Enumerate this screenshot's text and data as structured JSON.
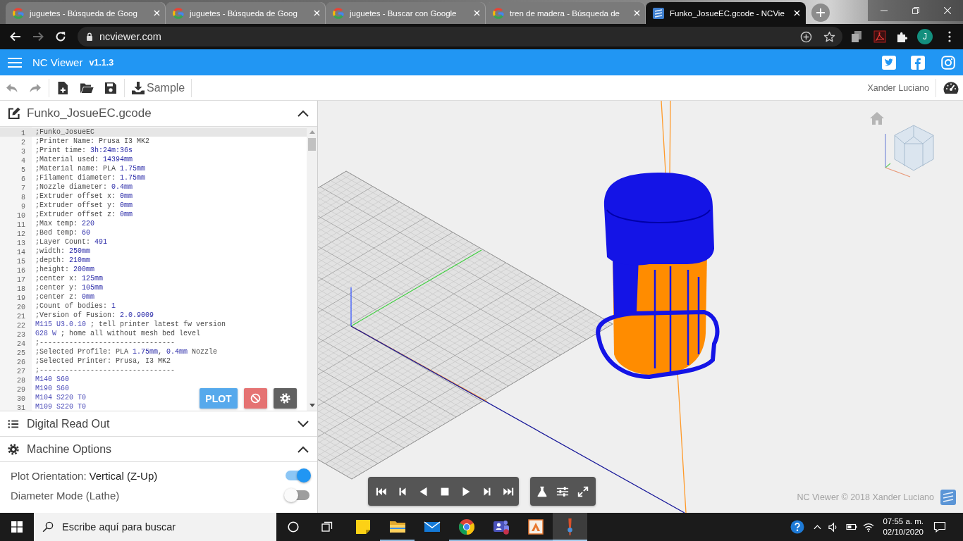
{
  "browser": {
    "tabs": [
      {
        "kind": "search",
        "title": "juguetes - Búsqueda de Goog",
        "selected": false
      },
      {
        "kind": "search",
        "title": "juguetes - Búsqueda de Goog",
        "selected": false
      },
      {
        "kind": "search",
        "title": "juguetes - Buscar con Google",
        "selected": false
      },
      {
        "kind": "search",
        "title": "tren de madera - Búsqueda de",
        "selected": false
      },
      {
        "kind": "app",
        "title": "Funko_JosueEC.gcode - NCVie",
        "selected": true
      }
    ],
    "back": {
      "disabled": false
    },
    "forward": {
      "disabled": true
    },
    "url": "ncviewer.com",
    "profile_initial": "J"
  },
  "app_bar": {
    "title": "NC Viewer",
    "version": "v1.1.3"
  },
  "toolbar": {
    "undo": {
      "disabled": true
    },
    "redo": {
      "disabled": true
    },
    "sample_button": "Sample",
    "author": "Xander Luciano"
  },
  "file_panel": {
    "title": "Funko_JosueEC.gcode",
    "expanded": true,
    "plot_button": "PLOT",
    "lines": [
      {
        "number": "1",
        "code": ";Funko_JosueEC",
        "selected": true
      },
      {
        "number": "2",
        "code": ";Printer Name: Prusa I3 MK2",
        "selected": false
      },
      {
        "number": "3",
        "code": ";Print time: 3h:24m:36s",
        "selected": false
      },
      {
        "number": "4",
        "code": ";Material used: 14394mm",
        "selected": false
      },
      {
        "number": "5",
        "code": ";Material name: PLA 1.75mm",
        "selected": false
      },
      {
        "number": "6",
        "code": ";Filament diameter: 1.75mm",
        "selected": false
      },
      {
        "number": "7",
        "code": ";Nozzle diameter: 0.4mm",
        "selected": false
      },
      {
        "number": "8",
        "code": ";Extruder offset x: 0mm",
        "selected": false
      },
      {
        "number": "9",
        "code": ";Extruder offset y: 0mm",
        "selected": false
      },
      {
        "number": "10",
        "code": ";Extruder offset z: 0mm",
        "selected": false
      },
      {
        "number": "11",
        "code": ";Max temp: 220",
        "selected": false
      },
      {
        "number": "12",
        "code": ";Bed temp: 60",
        "selected": false
      },
      {
        "number": "13",
        "code": ";Layer Count: 491",
        "selected": false
      },
      {
        "number": "14",
        "code": ";width: 250mm",
        "selected": false
      },
      {
        "number": "15",
        "code": ";depth: 210mm",
        "selected": false
      },
      {
        "number": "16",
        "code": ";height: 200mm",
        "selected": false
      },
      {
        "number": "17",
        "code": ";center x: 125mm",
        "selected": false
      },
      {
        "number": "18",
        "code": ";center y: 105mm",
        "selected": false
      },
      {
        "number": "19",
        "code": ";center z: 0mm",
        "selected": false
      },
      {
        "number": "20",
        "code": ";Count of bodies: 1",
        "selected": false
      },
      {
        "number": "21",
        "code": ";Version of Fusion: 2.0.9009",
        "selected": false
      },
      {
        "number": "22",
        "code": "M115 U3.0.10 ; tell printer latest fw version",
        "selected": false
      },
      {
        "number": "23",
        "code": "G28 W ; home all without mesh bed level",
        "selected": false
      },
      {
        "number": "24",
        "code": ";--------------------------------",
        "selected": false
      },
      {
        "number": "25",
        "code": ";Selected Profile: PLA 1.75mm, 0.4mm Nozzle",
        "selected": false
      },
      {
        "number": "26",
        "code": ";Selected Printer: Prusa, I3 MK2",
        "selected": false
      },
      {
        "number": "27",
        "code": ";--------------------------------",
        "selected": false
      },
      {
        "number": "28",
        "code": "M140 S60",
        "selected": false
      },
      {
        "number": "29",
        "code": "M190 S60",
        "selected": false
      },
      {
        "number": "30",
        "code": "M104 S220 T0",
        "selected": false
      },
      {
        "number": "31",
        "code": "M109 S220 T0",
        "selected": false
      }
    ]
  },
  "panels": [
    {
      "kind": "list",
      "title": "Digital Read Out",
      "expanded": false
    },
    {
      "kind": "settings",
      "title": "Machine Options",
      "expanded": true
    }
  ],
  "machine_options": [
    {
      "label": "Plot Orientation:",
      "value": "Vertical (Z-Up)",
      "on": true
    },
    {
      "label": "Diameter Mode (Lathe)",
      "on": false
    }
  ],
  "viewer": {
    "footer": "NC Viewer © 2018 Xander Luciano"
  },
  "taskbar": {
    "search": {
      "placeholder": "Escribe aquí para buscar"
    },
    "apps": [
      {
        "kind": "notes",
        "running": false,
        "selected": false
      },
      {
        "kind": "folder",
        "running": true,
        "selected": false
      },
      {
        "kind": "mail",
        "running": false,
        "selected": false
      },
      {
        "kind": "browser",
        "running": true,
        "selected": false
      },
      {
        "kind": "chat",
        "running": true,
        "selected": false
      },
      {
        "kind": "cad",
        "running": true,
        "selected": false
      },
      {
        "kind": "tool",
        "running": true,
        "selected": true
      }
    ],
    "time": "07:55 a. m.",
    "date": "02/10/2020"
  }
}
